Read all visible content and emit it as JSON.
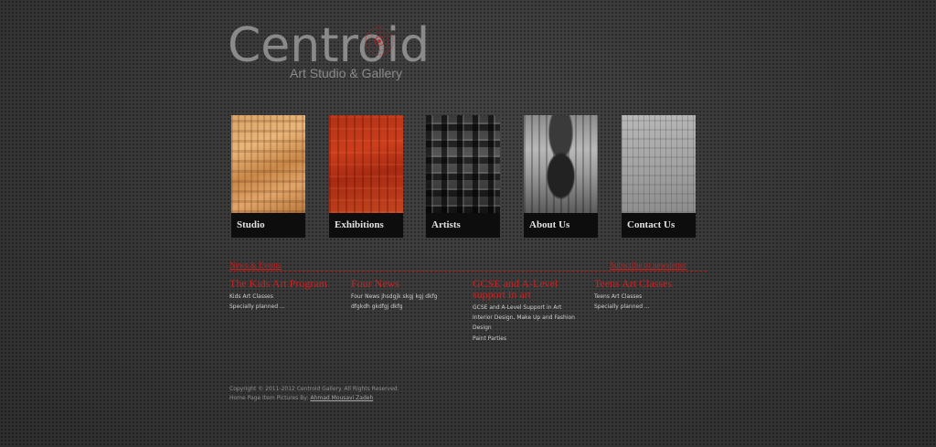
{
  "logo": {
    "name": "Centroid",
    "tagline": "Art Studio & Gallery",
    "accent_color": "#c41e1e"
  },
  "nav": {
    "tiles": [
      {
        "label": "Studio",
        "art": "orange-textured-painting"
      },
      {
        "label": "Exhibitions",
        "art": "red-textured-painting"
      },
      {
        "label": "Artists",
        "art": "black-grid-painting"
      },
      {
        "label": "About Us",
        "art": "grey-abstract-face-painting"
      },
      {
        "label": "Contact Us",
        "art": "light-grey-textured-painting"
      }
    ]
  },
  "news": {
    "left_link": "News & Events",
    "right_link": "Subscribe to newsletter",
    "items": [
      {
        "title": "The Kids Art Program",
        "lines": [
          "Kids Art Classes",
          "Specially planned ..."
        ]
      },
      {
        "title": "Four News",
        "lines": [
          "Four News jhsdgjk skgj kgj dkfg",
          "dfgkdh gkdfgj dkfg"
        ]
      },
      {
        "title": "GCSE and A-Level support in art",
        "lines": [
          "GCSE and A-Level Support in Art",
          "Interior Design, Make Up and Fashion",
          "Design",
          "Paint Parties"
        ]
      },
      {
        "title": "Teens Art Classes",
        "lines": [
          "Teens Art Classes",
          "Specially planned ..."
        ]
      }
    ]
  },
  "footer": {
    "copyright": "Copyright © 2011-2012 Centroid Gallery. All Rights Reserved.",
    "credit_prefix": "Home Page Item Pictures By: ",
    "credit_name": "Ahmad Mousavi Zadeh"
  }
}
